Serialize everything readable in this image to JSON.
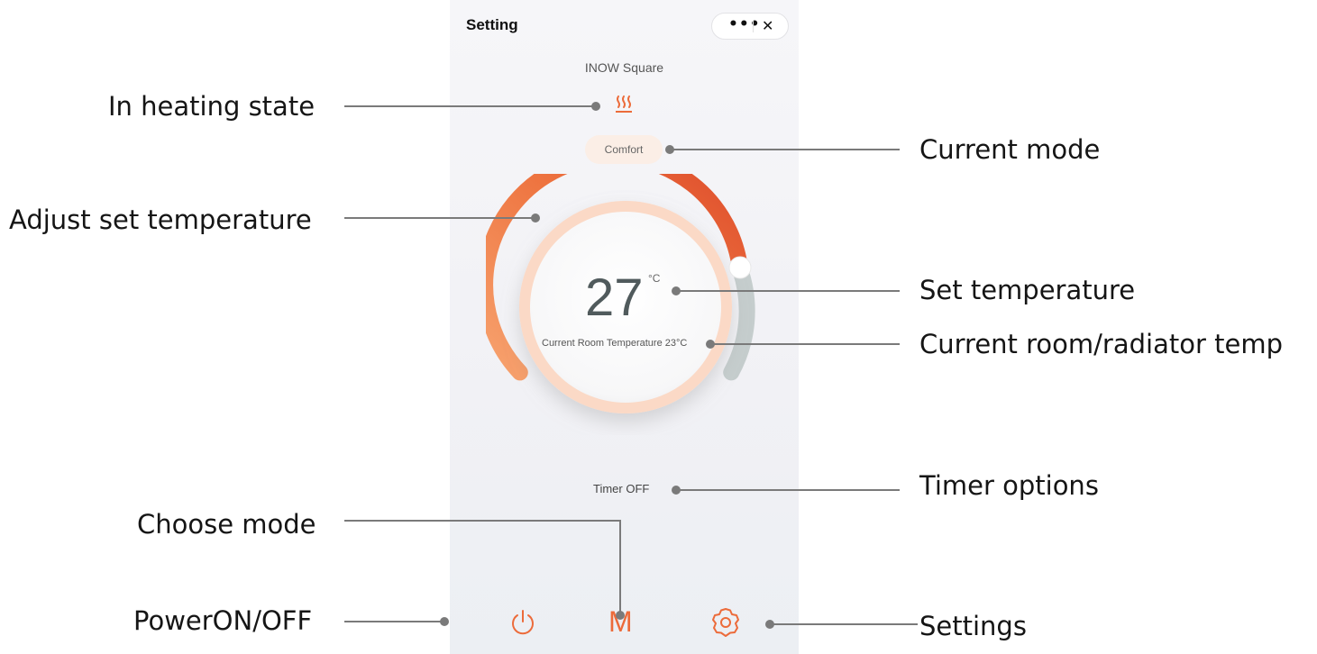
{
  "app": {
    "title": "Setting",
    "more_label": "•••",
    "close_label": "✕",
    "device_name": "INOW Square"
  },
  "status": {
    "heating_icon": "heating-waves-icon",
    "mode": "Comfort"
  },
  "thermostat": {
    "set_temperature": "27",
    "unit": "°C",
    "room_temperature_text": "Current Room Temperature 23°C",
    "set_temperature_value": 27
  },
  "timer": {
    "label": "Timer OFF"
  },
  "bottom_bar": {
    "power_icon": "power-icon",
    "mode_label": "M",
    "settings_icon": "gear-icon"
  },
  "annotations": {
    "heating_state": "In heating state",
    "adjust_set_temp": "Adjust set temperature",
    "choose_mode": "Choose mode",
    "power": "PowerON/OFF",
    "current_mode": "Current mode",
    "set_temperature": "Set temperature",
    "room_radiator_temp": "Current room/radiator temp",
    "timer_options": "Timer options",
    "settings": "Settings"
  },
  "colors": {
    "accent": "#ec6b3a",
    "arc_start": "#f59a66",
    "arc_end": "#e05331",
    "track": "#c5cdcd",
    "pill_bg": "#fbeee6"
  }
}
